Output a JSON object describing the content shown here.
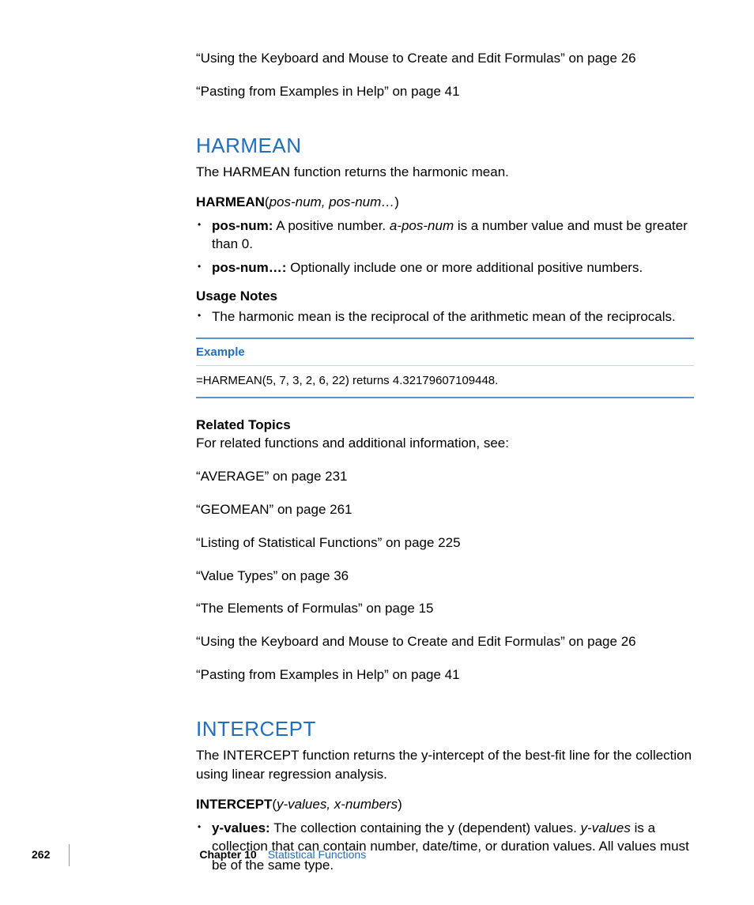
{
  "topLinks": [
    "“Using the Keyboard and Mouse to Create and Edit Formulas” on page 26",
    "“Pasting from Examples in Help” on page 41"
  ],
  "harmean": {
    "title": "HARMEAN",
    "desc": "The HARMEAN function returns the harmonic mean.",
    "syntax_name": "HARMEAN",
    "syntax_open": "(",
    "syntax_args": "pos-num, pos-num…",
    "syntax_close": ")",
    "params": [
      {
        "name": "pos-num:",
        "pre": "  A positive number. ",
        "ital": "a-pos-num",
        "post": " is a number value and must be greater than 0."
      },
      {
        "name": "pos-num…:",
        "pre": "  Optionally include one or more additional positive numbers.",
        "ital": "",
        "post": ""
      }
    ],
    "usage_h": "Usage Notes",
    "usage_items": [
      "The harmonic mean is the reciprocal of the arithmetic mean of the reciprocals."
    ],
    "example_h": "Example",
    "example_body": "=HARMEAN(5, 7, 3, 2, 6, 22) returns 4.32179607109448.",
    "related_h": "Related Topics",
    "related_desc": "For related functions and additional information, see:",
    "related_links": [
      "“AVERAGE” on page 231",
      "“GEOMEAN” on page 261",
      "“Listing of Statistical Functions” on page 225",
      "“Value Types” on page 36",
      "“The Elements of Formulas” on page 15",
      "“Using the Keyboard and Mouse to Create and Edit Formulas” on page 26",
      "“Pasting from Examples in Help” on page 41"
    ]
  },
  "intercept": {
    "title": "INTERCEPT",
    "desc": "The INTERCEPT function returns the y-intercept of the best-fit line for the collection using linear regression analysis.",
    "syntax_name": "INTERCEPT",
    "syntax_open": "(",
    "syntax_args": "y-values, x-numbers",
    "syntax_close": ")",
    "params": [
      {
        "name": "y-values:",
        "pre": "  The collection containing the y (dependent) values. ",
        "ital": "y-values",
        "post": " is a collection that can contain number, date/time, or duration values. All values must be of the same type."
      }
    ]
  },
  "footer": {
    "page": "262",
    "chapter_label": "Chapter 10",
    "chapter_name": "Statistical Functions"
  }
}
